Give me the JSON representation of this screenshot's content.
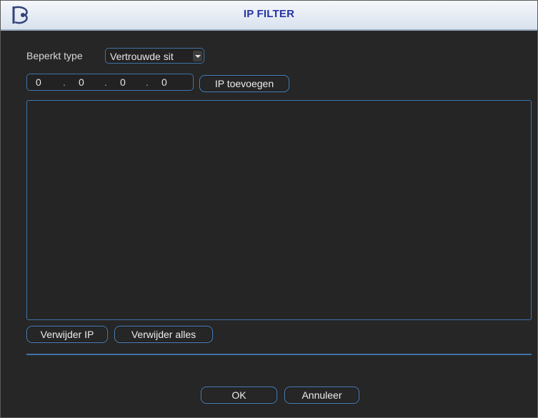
{
  "window": {
    "title": "IP FILTER"
  },
  "restrict": {
    "label": "Beperkt type",
    "selected": "Vertrouwde sit"
  },
  "ip_input": {
    "octets": [
      "0",
      "0",
      "0",
      "0"
    ],
    "separator": "."
  },
  "buttons": {
    "add_ip": "IP toevoegen",
    "delete_ip": "Verwijder IP",
    "delete_all": "Verwijder alles",
    "ok": "OK",
    "cancel": "Annuleer"
  },
  "ip_list": [],
  "colors": {
    "title_text": "#2733a6",
    "accent_border": "#3f73a8",
    "background": "#262626"
  }
}
